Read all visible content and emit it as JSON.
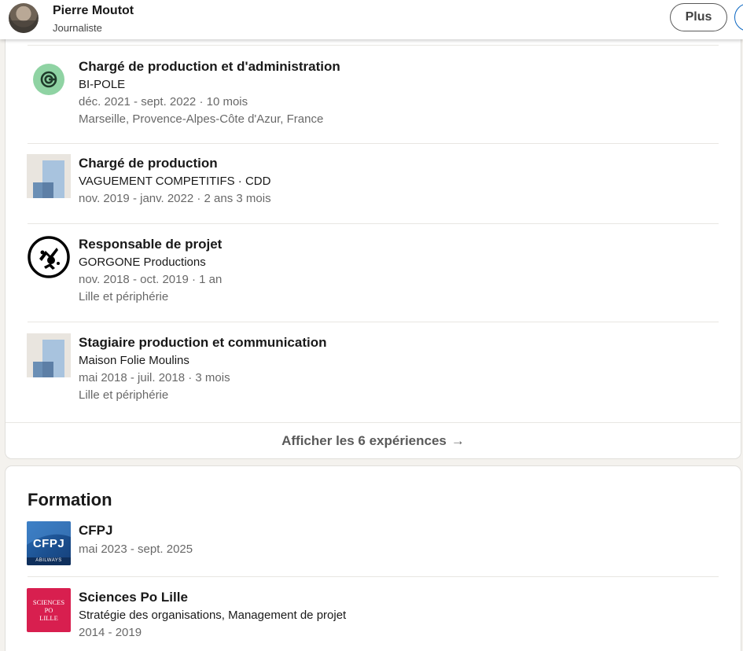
{
  "header": {
    "name": "Pierre Moutot",
    "headline": "Journaliste",
    "more_button": "Plus"
  },
  "experience": {
    "items": [
      {
        "title": "Chargé de production et d'administration",
        "company": "BI-POLE",
        "dates": "déc. 2021 - sept. 2022 · 10 mois",
        "location": "Marseille, Provence-Alpes-Côte d'Azur, France",
        "logo": "bi-pole-logo"
      },
      {
        "title": "Chargé de production",
        "company": "VAGUEMENT COMPETITIFS · CDD",
        "dates": "nov. 2019 - janv. 2022 · 2 ans 3 mois",
        "logo": "company-placeholder-logo"
      },
      {
        "title": "Responsable de projet",
        "company": "GORGONE Productions",
        "dates": "nov. 2018 - oct. 2019 · 1 an",
        "location": "Lille et périphérie",
        "logo": "gorgone-logo"
      },
      {
        "title": "Stagiaire production et communication",
        "company": "Maison Folie Moulins",
        "dates": "mai 2018 - juil. 2018 · 3 mois",
        "location": "Lille et périphérie",
        "logo": "company-placeholder-logo"
      }
    ],
    "show_all_label": "Afficher les 6 expériences",
    "arrow": "→"
  },
  "education": {
    "heading": "Formation",
    "items": [
      {
        "school": "CFPJ",
        "dates": "mai 2023 - sept. 2025",
        "logo_text": "CFPJ",
        "logo_subtext": "ABILWAYS"
      },
      {
        "school": "Sciences Po Lille",
        "field": "Stratégie des organisations, Management de projet",
        "dates": "2014 - 2019",
        "logo_lines": [
          "SCIENCES",
          "PO",
          "LILLE"
        ]
      }
    ]
  }
}
